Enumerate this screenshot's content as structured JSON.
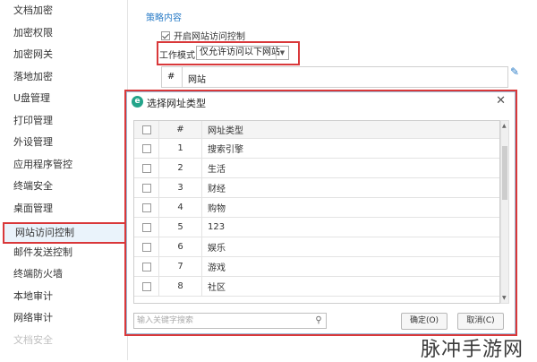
{
  "sidebar": {
    "items": [
      {
        "label": "文档加密",
        "state": "normal"
      },
      {
        "label": "加密权限",
        "state": "normal"
      },
      {
        "label": "加密网关",
        "state": "normal"
      },
      {
        "label": "落地加密",
        "state": "normal"
      },
      {
        "label": "U盘管理",
        "state": "normal"
      },
      {
        "label": "打印管理",
        "state": "normal"
      },
      {
        "label": "外设管理",
        "state": "normal"
      },
      {
        "label": "应用程序管控",
        "state": "normal"
      },
      {
        "label": "终端安全",
        "state": "normal"
      },
      {
        "label": "桌面管理",
        "state": "normal"
      },
      {
        "label": "网站访问控制",
        "state": "active"
      },
      {
        "label": "邮件发送控制",
        "state": "normal"
      },
      {
        "label": "终端防火墙",
        "state": "normal"
      },
      {
        "label": "本地审计",
        "state": "normal"
      },
      {
        "label": "网络审计",
        "state": "normal"
      },
      {
        "label": "文档安全",
        "state": "faded"
      }
    ]
  },
  "policy": {
    "section_title": "策略内容",
    "enable_label": "开启网站访问控制",
    "enable_checked": true,
    "mode_label": "工作模式",
    "mode_value": "仅允许访问以下网站"
  },
  "background_table": {
    "col_num": "#",
    "col_site": "网站"
  },
  "dialog": {
    "title": "选择网址类型",
    "close_label": "✕",
    "header": {
      "num": "#",
      "type": "网址类型"
    },
    "rows": [
      {
        "num": "1",
        "type": "搜索引擎"
      },
      {
        "num": "2",
        "type": "生活"
      },
      {
        "num": "3",
        "type": "财经"
      },
      {
        "num": "4",
        "type": "购物"
      },
      {
        "num": "5",
        "type": "123"
      },
      {
        "num": "6",
        "type": "娱乐"
      },
      {
        "num": "7",
        "type": "游戏"
      },
      {
        "num": "8",
        "type": "社区"
      }
    ],
    "search_placeholder": "输入关键字搜索",
    "ok_label": "确定(O)",
    "cancel_label": "取消(C)"
  },
  "watermark": "脉冲手游网",
  "colors": {
    "highlight": "#d9383a",
    "link": "#2a7cc7",
    "logo": "#23a48a"
  },
  "icons": [
    "edit-icon",
    "search-icon",
    "close-icon",
    "app-logo-icon",
    "checkbox-icon"
  ]
}
